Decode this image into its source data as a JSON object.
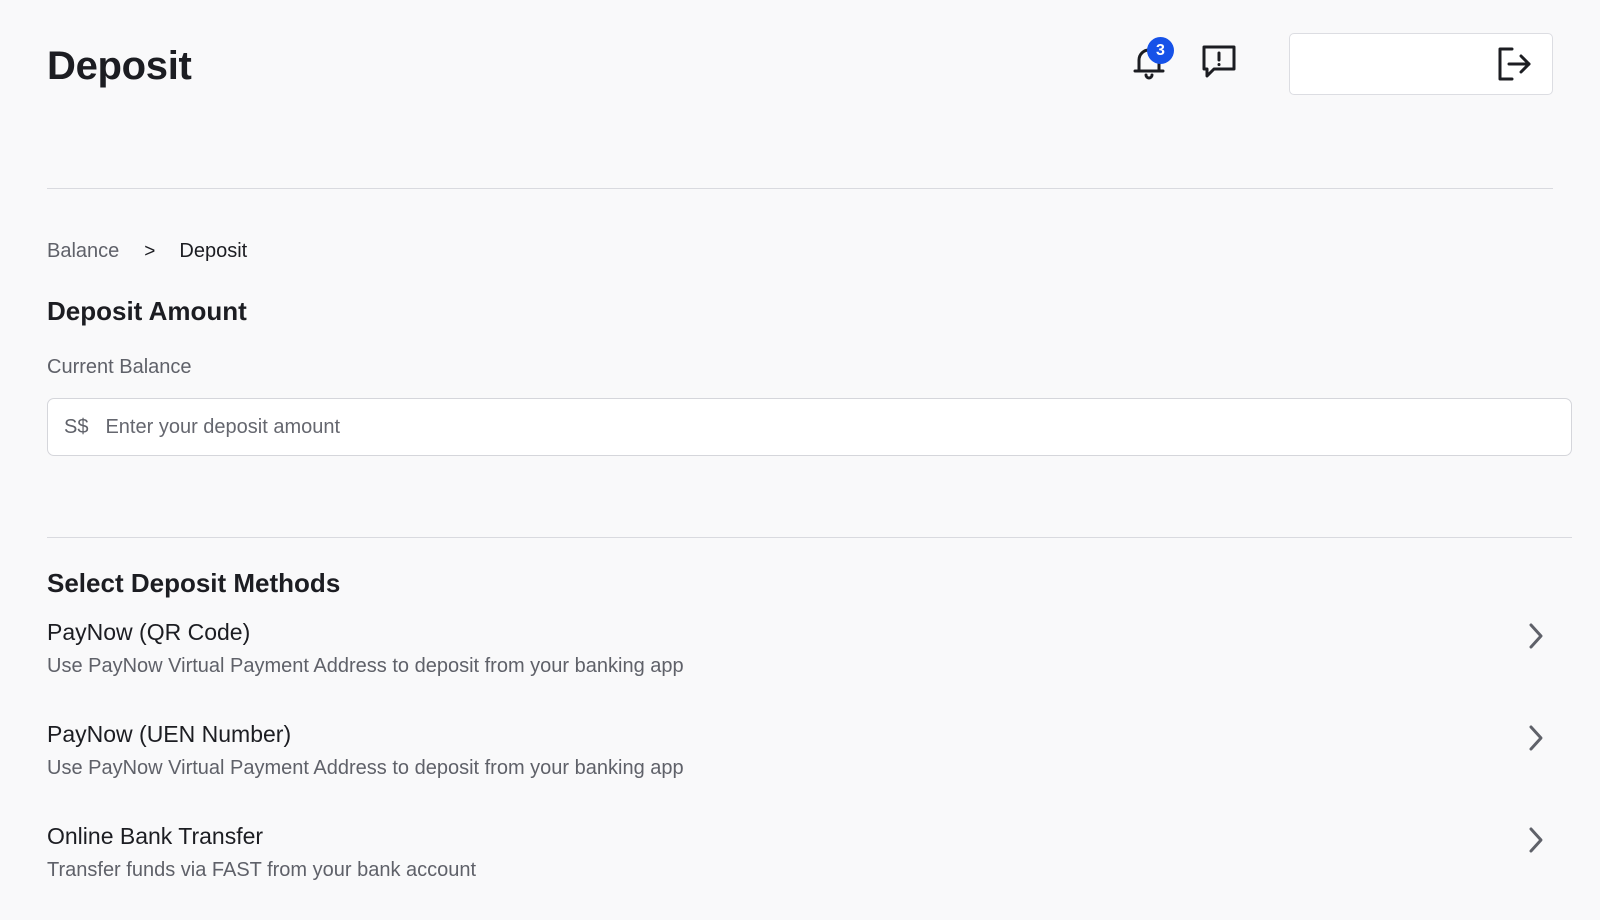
{
  "header": {
    "title": "Deposit",
    "notification_count": "3",
    "icons": {
      "notifications": "bell-icon",
      "feedback": "feedback-icon",
      "logout": "logout-icon"
    },
    "badge_color": "#1652e8"
  },
  "breadcrumb": {
    "items": [
      {
        "label": "Balance"
      },
      {
        "label": "Deposit"
      }
    ],
    "separator": ">"
  },
  "deposit_amount": {
    "title": "Deposit Amount",
    "balance_label": "Current Balance",
    "currency": "S$",
    "input_value": "",
    "input_placeholder": "Enter your deposit amount"
  },
  "methods": {
    "title": "Select Deposit Methods",
    "items": [
      {
        "name": "PayNow (QR Code)",
        "description": "Use PayNow Virtual Payment Address to deposit from your banking app"
      },
      {
        "name": "PayNow (UEN Number)",
        "description": "Use PayNow Virtual Payment Address to deposit from your banking app"
      },
      {
        "name": "Online Bank Transfer",
        "description": "Transfer funds via FAST from your bank account"
      }
    ]
  }
}
